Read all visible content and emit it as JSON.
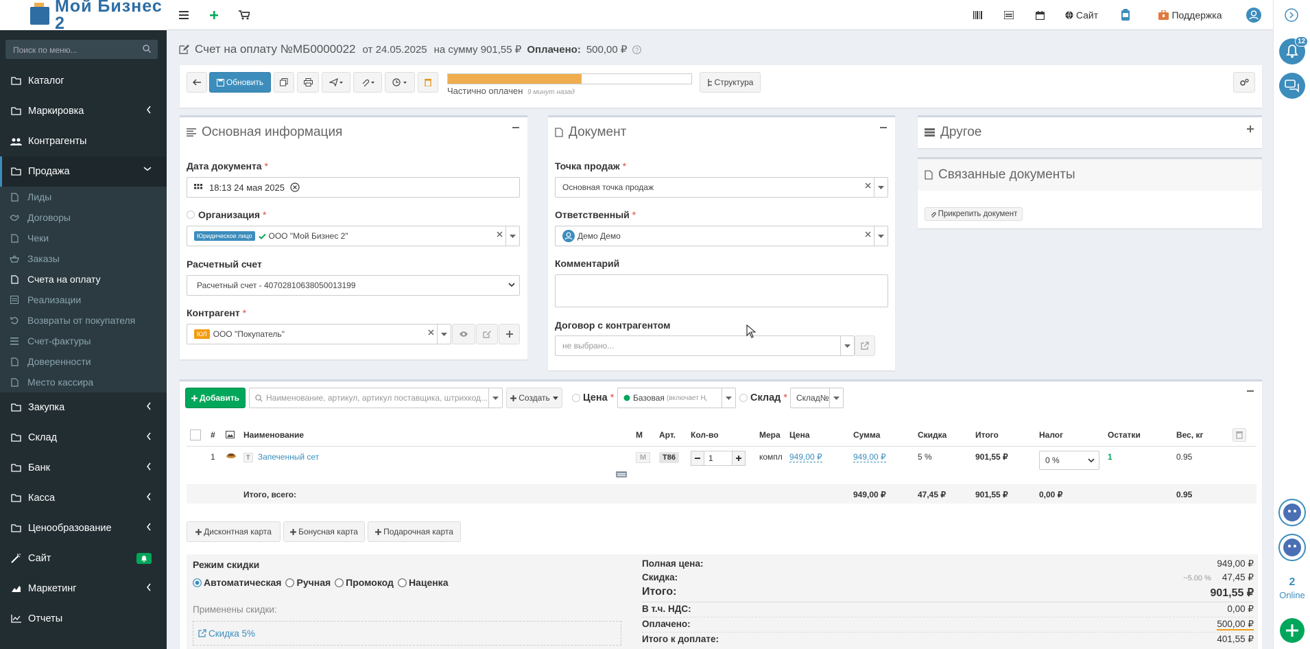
{
  "header": {
    "logo_text": "Мой Бизнес 2",
    "site_label": "Сайт",
    "support_label": "Поддержка"
  },
  "right_strip": {
    "notif_count": "12",
    "online_count": "2",
    "online_label": "Online"
  },
  "sidebar": {
    "search_placeholder": "Поиск по меню...",
    "items": [
      {
        "label": "Каталог"
      },
      {
        "label": "Маркировка"
      },
      {
        "label": "Контрагенты"
      },
      {
        "label": "Продажа"
      },
      {
        "label": "Закупка"
      },
      {
        "label": "Склад"
      },
      {
        "label": "Банк"
      },
      {
        "label": "Касса"
      },
      {
        "label": "Ценообразование"
      },
      {
        "label": "Сайт"
      },
      {
        "label": "Маркетинг"
      },
      {
        "label": "Отчеты"
      }
    ],
    "sub_items": [
      {
        "label": "Лиды"
      },
      {
        "label": "Договоры"
      },
      {
        "label": "Чеки"
      },
      {
        "label": "Заказы"
      },
      {
        "label": "Счета на оплату"
      },
      {
        "label": "Реализации"
      },
      {
        "label": "Возвраты от покупателя"
      },
      {
        "label": "Счет-фактуры"
      },
      {
        "label": "Доверенности"
      },
      {
        "label": "Место кассира"
      }
    ]
  },
  "document": {
    "title": "Счет на оплату №МБ0000022",
    "date_part": "от 24.05.2025",
    "sum_part": "на сумму 901,55 ₽",
    "paid_label": "Оплачено:",
    "paid_value": "500,00 ₽"
  },
  "toolbar": {
    "update_label": "Обновить",
    "status_text": "Частично оплачен",
    "status_time": "9 минут назад",
    "progress_fraction": 0.55,
    "structure_label": "Структура"
  },
  "main_info": {
    "title": "Основная информация",
    "date_label": "Дата документа",
    "date_value": "18:13 24 мая 2025",
    "org_label": "Организация",
    "org_tag": "Юридическое лицо",
    "org_value": "ООО \"Мой Бизнес 2\"",
    "account_label": "Расчетный счет",
    "account_value": "Расчетный счет - 40702810638050013199",
    "contractor_label": "Контрагент",
    "contractor_tag": "ЮЛ",
    "contractor_value": "ООО \"Покупатель\""
  },
  "doc_panel": {
    "title": "Документ",
    "point_label": "Точка продаж",
    "point_value": "Основная точка продаж",
    "responsible_label": "Ответственный",
    "responsible_value": "Демо Демо",
    "comment_label": "Комментарий",
    "contract_label": "Договор с контрагентом",
    "contract_placeholder": "не выбрано..."
  },
  "other_panel": {
    "title": "Другое"
  },
  "linked_panel": {
    "title": "Связанные документы",
    "attach_label": "Прикрепить документ"
  },
  "items_toolbar": {
    "add_label": "Добавить",
    "search_placeholder": "Наименование, артикул, артикул поставщика, штрихкод...",
    "create_label": "Создать",
    "price_label": "Цена",
    "price_value": "Базовая",
    "price_note": "(включает НДС)",
    "warehouse_label": "Склад",
    "warehouse_value": "Склад№"
  },
  "table": {
    "headers": [
      "#",
      "Наименование",
      "М",
      "Арт.",
      "Кол-во",
      "Мера",
      "Цена",
      "Сумма",
      "Скидка",
      "Итого",
      "Налог",
      "Остатки",
      "Вес, кг"
    ],
    "row": {
      "num": "1",
      "type_tag": "Т",
      "name": "Запеченный сет",
      "mark": "М",
      "art": "Т86",
      "qty": "1",
      "unit": "компл",
      "price": "949,00 ₽",
      "sum": "949,00 ₽",
      "discount": "5 %",
      "total": "901,55 ₽",
      "tax": "0 %",
      "stock": "1",
      "weight": "0.95"
    },
    "totals": {
      "label": "Итого, всего:",
      "sum": "949,00 ₽",
      "discount": "47,45 ₽",
      "total": "901,55 ₽",
      "tax": "0,00 ₽",
      "weight": "0.95"
    }
  },
  "cards": {
    "discount_card": "Дисконтная карта",
    "bonus_card": "Бонусная карта",
    "gift_card": "Подарочная карта"
  },
  "discount_mode": {
    "title": "Режим скидки",
    "options": [
      "Автоматическая",
      "Ручная",
      "Промокод",
      "Наценка"
    ],
    "applied_label": "Применены скидки:",
    "applied_item": "Скидка 5%"
  },
  "summary": {
    "full_price_label": "Полная цена:",
    "full_price": "949,00 ₽",
    "discount_label": "Скидка:",
    "discount_pct": "~5.00 %",
    "discount_value": "47,45 ₽",
    "total_label": "Итого:",
    "total_value": "901,55 ₽",
    "vat_label": "В т.ч. НДС:",
    "vat_value": "0,00 ₽",
    "paid_label": "Оплачено:",
    "paid_value": "500,00 ₽",
    "to_pay_label": "Итого к доплате:",
    "to_pay_value": "401,55 ₽"
  },
  "colors": {
    "sidebar_bg": "#222d32",
    "primary": "#3c8dbc",
    "success": "#00a65a",
    "progress": "#f0ad4e",
    "danger": "#dd4b39"
  }
}
